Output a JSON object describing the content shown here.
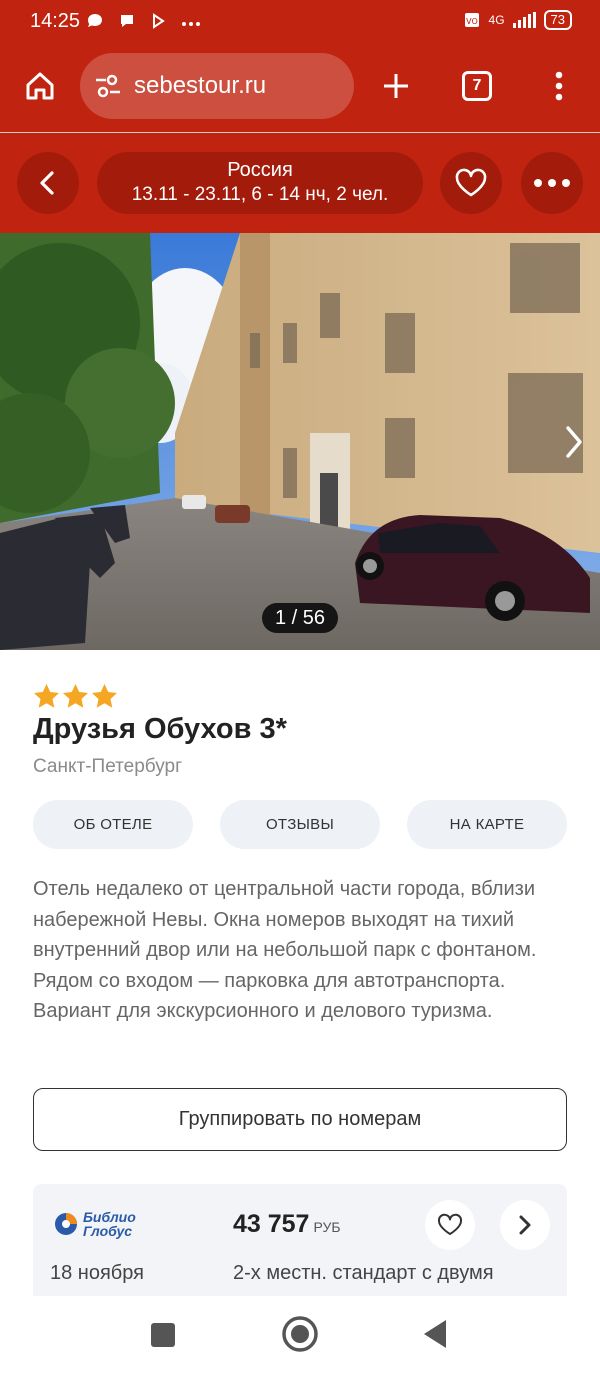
{
  "status_bar": {
    "time": "14:25",
    "network": "4G",
    "battery": "73"
  },
  "browser": {
    "url": "sebestour.ru",
    "tab_count": "7"
  },
  "search": {
    "country": "Россия",
    "params": "13.11 - 23.11, 6 - 14 нч, 2 чел."
  },
  "gallery": {
    "counter": "1 / 56"
  },
  "hotel": {
    "stars": 3,
    "name": "Друзья Обухов 3*",
    "city": "Санкт-Петербург",
    "tabs": [
      {
        "label": "ОБ ОТЕЛЕ"
      },
      {
        "label": "ОТЗЫВЫ"
      },
      {
        "label": "НА КАРТЕ"
      }
    ],
    "description": "Отель недалеко от центральной части города, вблизи набережной Невы. Окна номеров выходят на тихий внутренний двор или на небольшой парк с фонтаном. Рядом со входом — парковка для автотранспорта. Вариант для экскурсионного и делового туризма."
  },
  "group_button": {
    "label": "Группировать по номерам"
  },
  "offer": {
    "operator_line1": "Библио",
    "operator_line2": "Глобус",
    "price": "43 757",
    "currency": "РУБ",
    "date": "18 ноября",
    "room": "2-х местн. стандарт с двумя"
  },
  "colors": {
    "brand": "#c0230f",
    "brand_dark": "#a31b0a",
    "star": "#f5a623"
  }
}
